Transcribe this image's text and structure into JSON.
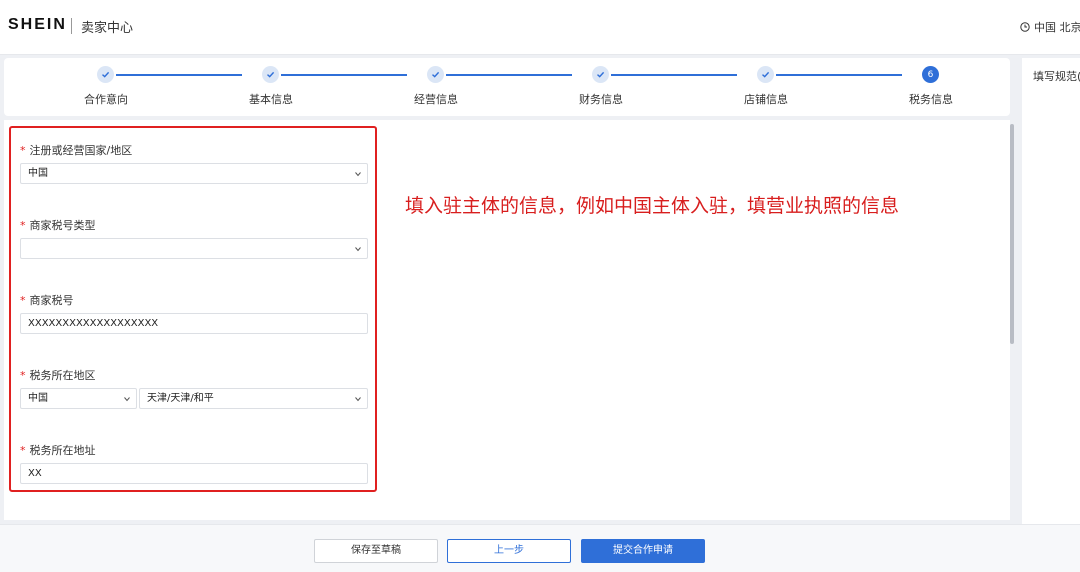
{
  "header": {
    "logo": "SHEIN",
    "app_name": "卖家中心",
    "region": "中国 北京"
  },
  "stepper": {
    "steps": [
      {
        "label": "合作意向",
        "state": "done"
      },
      {
        "label": "基本信息",
        "state": "done"
      },
      {
        "label": "经营信息",
        "state": "done"
      },
      {
        "label": "财务信息",
        "state": "done"
      },
      {
        "label": "店铺信息",
        "state": "done"
      },
      {
        "label": "税务信息",
        "state": "active",
        "number": "6"
      }
    ]
  },
  "right_panel": {
    "title": "填写规范("
  },
  "form": {
    "fields": [
      {
        "label": "注册或经营国家/地区",
        "required": true,
        "type": "select",
        "value": "中国"
      },
      {
        "label": "商家税号类型",
        "required": true,
        "type": "select",
        "value": ""
      },
      {
        "label": "商家税号",
        "required": true,
        "type": "input",
        "value": "XXXXXXXXXXXXXXXXXXX"
      },
      {
        "label": "税务所在地区",
        "required": true,
        "type": "double-select",
        "value_country": "中国",
        "value_region": "天津/天津/和平"
      },
      {
        "label": "税务所在地址",
        "required": true,
        "type": "input",
        "value": "XX"
      }
    ]
  },
  "annotation": "填入驻主体的信息，例如中国主体入驻，填营业执照的信息",
  "buttons": {
    "draft": "保存至草稿",
    "prev": "上一步",
    "submit": "提交合作申请"
  },
  "colors": {
    "primary": "#2f6fd8",
    "highlight": "#e02020",
    "annotation": "#d81e1e"
  }
}
